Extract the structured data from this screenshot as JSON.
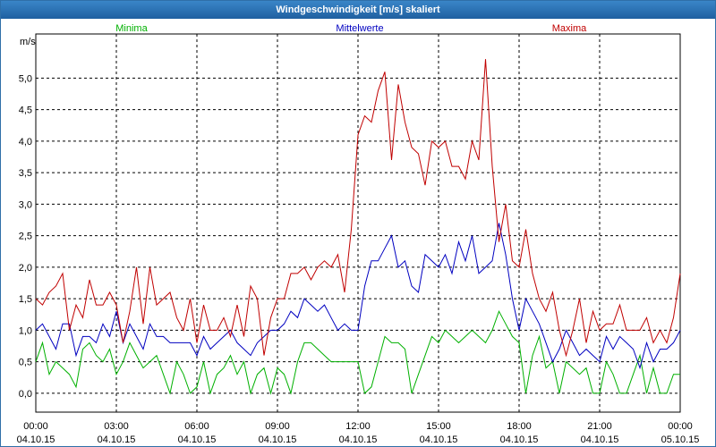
{
  "window": {
    "title": "Windgeschwindigkeit [m/s] skaliert"
  },
  "chart_data": {
    "type": "line",
    "title": "Windgeschwindigkeit [m/s] skaliert",
    "ylabel": "m/s",
    "xlabel": "",
    "ylim": [
      -0.3,
      5.7
    ],
    "yticks": [
      0.0,
      0.5,
      1.0,
      1.5,
      2.0,
      2.5,
      3.0,
      3.5,
      4.0,
      4.5,
      5.0
    ],
    "ytick_labels": [
      "0,0",
      "0,5",
      "1,0",
      "1,5",
      "2,0",
      "2,5",
      "3,0",
      "3,5",
      "4,0",
      "4,5",
      "5,0"
    ],
    "xlim": [
      0,
      24
    ],
    "xticks": [
      {
        "hour": 0,
        "time": "00:00",
        "date": "04.10.15"
      },
      {
        "hour": 3,
        "time": "03:00",
        "date": "04.10.15"
      },
      {
        "hour": 6,
        "time": "06:00",
        "date": "04.10.15"
      },
      {
        "hour": 9,
        "time": "09:00",
        "date": "04.10.15"
      },
      {
        "hour": 12,
        "time": "12:00",
        "date": "04.10.15"
      },
      {
        "hour": 15,
        "time": "15:00",
        "date": "04.10.15"
      },
      {
        "hour": 18,
        "time": "18:00",
        "date": "04.10.15"
      },
      {
        "hour": 21,
        "time": "21:00",
        "date": "04.10.15"
      },
      {
        "hour": 24,
        "time": "00:00",
        "date": "05.10.15"
      }
    ],
    "grid": true,
    "legend_position": "top",
    "x": [
      0.0,
      0.25,
      0.5,
      0.75,
      1.0,
      1.25,
      1.5,
      1.75,
      2.0,
      2.25,
      2.5,
      2.75,
      3.0,
      3.25,
      3.5,
      3.75,
      4.0,
      4.25,
      4.5,
      4.75,
      5.0,
      5.25,
      5.5,
      5.75,
      6.0,
      6.25,
      6.5,
      6.75,
      7.0,
      7.25,
      7.5,
      7.75,
      8.0,
      8.25,
      8.5,
      8.75,
      9.0,
      9.25,
      9.5,
      9.75,
      10.0,
      10.25,
      10.5,
      10.75,
      11.0,
      11.25,
      11.5,
      11.75,
      12.0,
      12.25,
      12.5,
      12.75,
      13.0,
      13.25,
      13.5,
      13.75,
      14.0,
      14.25,
      14.5,
      14.75,
      15.0,
      15.25,
      15.5,
      15.75,
      16.0,
      16.25,
      16.5,
      16.75,
      17.0,
      17.25,
      17.5,
      17.75,
      18.0,
      18.25,
      18.5,
      18.75,
      19.0,
      19.25,
      19.5,
      19.75,
      20.0,
      20.25,
      20.5,
      20.75,
      21.0,
      21.25,
      21.5,
      21.75,
      22.0,
      22.25,
      22.5,
      22.75,
      23.0,
      23.25,
      23.5,
      23.75,
      24.0
    ],
    "series": [
      {
        "name": "Minima",
        "color": "#00b000",
        "values": [
          0.5,
          0.8,
          0.3,
          0.5,
          0.4,
          0.3,
          0.1,
          0.7,
          0.8,
          0.6,
          0.5,
          0.7,
          0.3,
          0.5,
          0.8,
          0.6,
          0.4,
          0.5,
          0.6,
          0.3,
          0.0,
          0.5,
          0.3,
          0.0,
          0.1,
          0.5,
          0.0,
          0.3,
          0.4,
          0.6,
          0.3,
          0.5,
          0.0,
          0.3,
          0.4,
          0.0,
          0.4,
          0.3,
          0.0,
          0.5,
          0.8,
          0.8,
          0.7,
          0.6,
          0.5,
          0.5,
          0.5,
          0.5,
          0.5,
          0.0,
          0.1,
          0.5,
          0.9,
          0.8,
          0.8,
          0.7,
          0.0,
          0.3,
          0.6,
          0.9,
          0.8,
          1.0,
          0.9,
          0.8,
          0.9,
          1.0,
          0.9,
          0.8,
          1.0,
          1.3,
          1.1,
          0.9,
          0.8,
          0.0,
          0.6,
          0.9,
          0.4,
          0.5,
          0.0,
          0.5,
          0.4,
          0.3,
          0.4,
          0.0,
          0.0,
          0.5,
          0.3,
          0.0,
          0.0,
          0.3,
          0.6,
          0.0,
          0.4,
          0.0,
          0.0,
          0.3,
          0.3
        ]
      },
      {
        "name": "Mittelwerte",
        "color": "#0000c0",
        "values": [
          1.0,
          1.1,
          0.9,
          0.7,
          1.1,
          1.1,
          0.6,
          0.9,
          0.9,
          0.8,
          1.1,
          0.9,
          1.3,
          0.8,
          1.1,
          0.9,
          0.7,
          1.1,
          0.9,
          0.9,
          0.8,
          0.8,
          0.8,
          0.8,
          0.6,
          0.9,
          0.7,
          0.8,
          0.9,
          1.0,
          0.8,
          0.7,
          0.6,
          0.8,
          0.9,
          1.0,
          1.0,
          1.1,
          1.3,
          1.2,
          1.5,
          1.4,
          1.3,
          1.4,
          1.2,
          1.0,
          1.1,
          1.0,
          1.0,
          1.7,
          2.1,
          2.1,
          2.3,
          2.5,
          2.0,
          2.1,
          1.7,
          1.6,
          2.2,
          2.1,
          2.0,
          2.2,
          1.9,
          2.4,
          2.1,
          2.5,
          1.9,
          2.0,
          2.1,
          2.7,
          2.2,
          1.5,
          1.0,
          1.5,
          1.3,
          1.1,
          0.8,
          0.5,
          0.7,
          1.0,
          0.8,
          0.6,
          0.7,
          0.6,
          0.5,
          0.9,
          0.7,
          0.9,
          0.8,
          0.7,
          0.4,
          0.8,
          0.5,
          0.7,
          0.7,
          0.8,
          1.0
        ]
      },
      {
        "name": "Maxima",
        "color": "#c00000",
        "values": [
          1.5,
          1.4,
          1.6,
          1.7,
          1.9,
          1.0,
          1.4,
          1.2,
          1.8,
          1.4,
          1.4,
          1.6,
          1.4,
          0.8,
          1.3,
          2.0,
          1.1,
          2.0,
          1.4,
          1.5,
          1.6,
          1.2,
          1.0,
          1.5,
          0.8,
          1.4,
          1.0,
          1.0,
          1.2,
          0.9,
          1.4,
          0.9,
          1.7,
          1.5,
          0.6,
          1.2,
          1.5,
          1.5,
          1.9,
          1.9,
          2.0,
          1.8,
          2.0,
          2.1,
          2.0,
          2.2,
          1.6,
          2.6,
          4.1,
          4.4,
          4.3,
          4.8,
          5.1,
          3.7,
          4.9,
          4.3,
          3.9,
          3.8,
          3.3,
          4.0,
          3.9,
          4.0,
          3.6,
          3.6,
          3.4,
          4.0,
          3.7,
          5.3,
          3.6,
          2.4,
          3.0,
          2.1,
          2.0,
          2.6,
          1.9,
          1.5,
          1.3,
          1.6,
          1.0,
          0.6,
          1.0,
          1.5,
          0.8,
          1.3,
          1.0,
          1.1,
          1.1,
          1.4,
          1.0,
          1.0,
          1.0,
          1.2,
          0.8,
          1.0,
          0.8,
          1.2,
          1.9
        ]
      }
    ]
  }
}
